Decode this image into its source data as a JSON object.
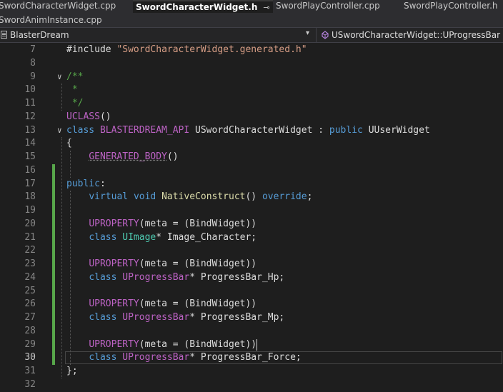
{
  "tabs_row1": [
    {
      "label": "SwordCharacterWidget.cpp",
      "active": false
    },
    {
      "label": "SwordCharacterWidget.h",
      "active": true,
      "pin": "⊸",
      "close": "✕"
    },
    {
      "label": "SwordPlayController.cpp",
      "active": false
    },
    {
      "label": "SwordPlayController.h",
      "active": false
    }
  ],
  "tabs_row2": [
    {
      "label": "SwordAnimInstance.cpp",
      "active": false
    }
  ],
  "navbar": {
    "project": "BlasterDream",
    "dropdown_icon": "chevron-down-icon",
    "member": "USwordCharacterWidget::UProgressBar",
    "member_icon": "class-member-icon"
  },
  "editor": {
    "lines": [
      {
        "n": "7",
        "tokens": [
          {
            "t": "#include ",
            "c": "pl"
          },
          {
            "t": "\"SwordCharacterWidget.generated.h\"",
            "c": "str"
          }
        ]
      },
      {
        "n": "8",
        "tokens": []
      },
      {
        "n": "9",
        "tokens": [
          {
            "t": "/**",
            "c": "cm"
          }
        ]
      },
      {
        "n": "10",
        "tokens": [
          {
            "t": " *",
            "c": "cm"
          }
        ]
      },
      {
        "n": "11",
        "tokens": [
          {
            "t": " */",
            "c": "cm"
          }
        ]
      },
      {
        "n": "12",
        "tokens": [
          {
            "t": "UCLASS",
            "c": "mac"
          },
          {
            "t": "()",
            "c": "pl"
          }
        ]
      },
      {
        "n": "13",
        "tokens": [
          {
            "t": "class ",
            "c": "kw"
          },
          {
            "t": "BLASTERDREAM_API ",
            "c": "mac"
          },
          {
            "t": "USwordCharacterWidget",
            "c": "pl"
          },
          {
            "t": " : ",
            "c": "pl"
          },
          {
            "t": "public ",
            "c": "kw"
          },
          {
            "t": "UUserWidget",
            "c": "pl"
          }
        ]
      },
      {
        "n": "14",
        "tokens": [
          {
            "t": "{",
            "c": "pl"
          }
        ]
      },
      {
        "n": "15",
        "tokens": [
          {
            "t": "    ",
            "c": "pl"
          },
          {
            "t": "GENERATED_BODY",
            "c": "mac sq"
          },
          {
            "t": "()",
            "c": "pl"
          }
        ]
      },
      {
        "n": "16",
        "tokens": []
      },
      {
        "n": "17",
        "tokens": [
          {
            "t": "public",
            "c": "kw"
          },
          {
            "t": ":",
            "c": "pl"
          }
        ]
      },
      {
        "n": "18",
        "tokens": [
          {
            "t": "    ",
            "c": "pl"
          },
          {
            "t": "virtual ",
            "c": "kw"
          },
          {
            "t": "void ",
            "c": "kw"
          },
          {
            "t": "NativeConstruct",
            "c": "fn"
          },
          {
            "t": "() ",
            "c": "pl"
          },
          {
            "t": "override",
            "c": "kw"
          },
          {
            "t": ";",
            "c": "pl"
          }
        ]
      },
      {
        "n": "19",
        "tokens": []
      },
      {
        "n": "20",
        "tokens": [
          {
            "t": "    ",
            "c": "pl"
          },
          {
            "t": "UPROPERTY",
            "c": "mac"
          },
          {
            "t": "(meta = (BindWidget))",
            "c": "pl"
          }
        ]
      },
      {
        "n": "21",
        "tokens": [
          {
            "t": "    ",
            "c": "pl"
          },
          {
            "t": "class ",
            "c": "kw"
          },
          {
            "t": "UImage",
            "c": "ty"
          },
          {
            "t": "* Image_Character;",
            "c": "pl"
          }
        ]
      },
      {
        "n": "22",
        "tokens": []
      },
      {
        "n": "23",
        "tokens": [
          {
            "t": "    ",
            "c": "pl"
          },
          {
            "t": "UPROPERTY",
            "c": "mac"
          },
          {
            "t": "(meta = (BindWidget))",
            "c": "pl"
          }
        ]
      },
      {
        "n": "24",
        "tokens": [
          {
            "t": "    ",
            "c": "pl"
          },
          {
            "t": "class ",
            "c": "kw"
          },
          {
            "t": "UProgressBar",
            "c": "mac"
          },
          {
            "t": "* ProgressBar_Hp;",
            "c": "pl"
          }
        ]
      },
      {
        "n": "25",
        "tokens": []
      },
      {
        "n": "26",
        "tokens": [
          {
            "t": "    ",
            "c": "pl"
          },
          {
            "t": "UPROPERTY",
            "c": "mac"
          },
          {
            "t": "(meta = (BindWidget))",
            "c": "pl"
          }
        ]
      },
      {
        "n": "27",
        "tokens": [
          {
            "t": "    ",
            "c": "pl"
          },
          {
            "t": "class ",
            "c": "kw"
          },
          {
            "t": "UProgressBar",
            "c": "mac"
          },
          {
            "t": "* ProgressBar_Mp;",
            "c": "pl"
          }
        ]
      },
      {
        "n": "28",
        "tokens": []
      },
      {
        "n": "29",
        "tokens": [
          {
            "t": "    ",
            "c": "pl"
          },
          {
            "t": "UPROPERTY",
            "c": "mac"
          },
          {
            "t": "(meta = (BindWidget))",
            "c": "pl"
          }
        ]
      },
      {
        "n": "30",
        "tokens": [
          {
            "t": "    ",
            "c": "pl"
          },
          {
            "t": "class ",
            "c": "kw"
          },
          {
            "t": "UProgressBar",
            "c": "mac"
          },
          {
            "t": "* ProgressBar_Force;",
            "c": "pl"
          }
        ]
      },
      {
        "n": "31",
        "tokens": [
          {
            "t": "};",
            "c": "pl"
          }
        ]
      },
      {
        "n": "32",
        "tokens": []
      }
    ],
    "current_line": "30",
    "fold_markers": [
      "9",
      "13"
    ],
    "changed_lines": [
      "16",
      "17",
      "18",
      "19",
      "20",
      "21",
      "22",
      "23",
      "24",
      "25",
      "26",
      "27",
      "28",
      "29",
      "30"
    ]
  },
  "colors": {
    "background": "#1e1e1e",
    "keyword": "#569cd6",
    "macro": "#bd63c5",
    "string": "#d69d85",
    "comment": "#57a64a",
    "type": "#4ec9b0",
    "function": "#dcdcaa",
    "change_bar": "#57a64a"
  }
}
